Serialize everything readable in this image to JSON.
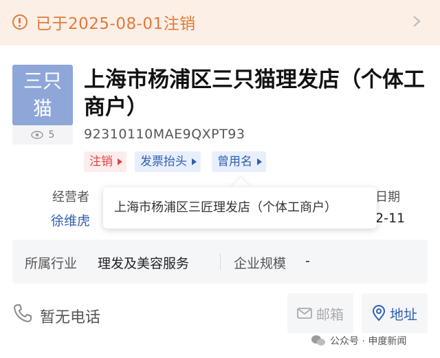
{
  "banner": {
    "status_text": "已于2025-08-01注销",
    "icon": "warning-circle-icon",
    "accent": "#e07a3a"
  },
  "company": {
    "logo_line1": "三只",
    "logo_line2": "猫",
    "view_count": "5",
    "name": "上海市杨浦区三只猫理发店（个体工商户）",
    "credit_code": "92310110MAE9QXPT93"
  },
  "tags": {
    "status": "注销",
    "invoice": "发票抬头",
    "former_name": "曾用名"
  },
  "details": {
    "operator_label": "经营者",
    "operator_name": "徐维虎",
    "date_label_partial": "日期",
    "date_value_partial": "2-11"
  },
  "popup": {
    "former_name_text": "上海市杨浦区三匠理发店（个体工商户）"
  },
  "info": {
    "industry_label": "所属行业",
    "industry_value": "理发及美容服务",
    "scale_label": "企业规模",
    "scale_value": "-"
  },
  "contact": {
    "phone_text": "暂无电话",
    "mail_label": "邮箱",
    "address_label": "地址"
  },
  "watermark": {
    "text": "公众号 · 申度新闻"
  },
  "colors": {
    "link_blue": "#2f5fb3",
    "tag_red": "#e04545",
    "logo_bg": "#8ea6d8"
  }
}
